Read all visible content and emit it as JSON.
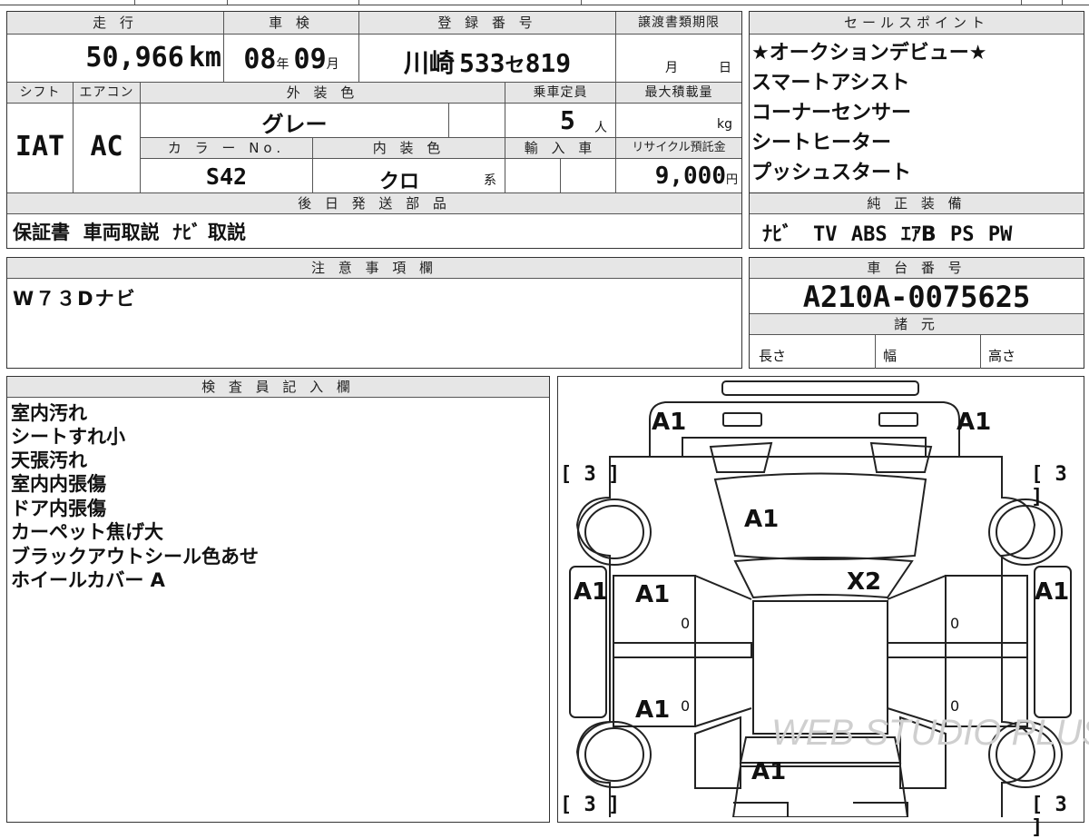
{
  "vehicle": {
    "mileage_label": "走 行",
    "mileage_value": "50,966",
    "mileage_unit": "km",
    "inspection_label": "車 検",
    "inspection_year": "08",
    "inspection_year_unit": "年",
    "inspection_month": "09",
    "inspection_month_unit": "月",
    "registration_label": "登 録 番 号",
    "registration_area": "川崎",
    "registration_class": "533",
    "registration_kana": "セ",
    "registration_number": "819",
    "transfer_deadline_label": "譲渡書類期限",
    "transfer_month_unit": "月",
    "transfer_day_unit": "日",
    "shift_label": "シフト",
    "shift_value": "IAT",
    "ac_label": "エアコン",
    "ac_value": "AC",
    "exterior_color_label": "外 装 色",
    "exterior_color_value": "グレー",
    "capacity_label": "乗車定員",
    "capacity_value": "5",
    "capacity_unit": "人",
    "max_load_label": "最大積載量",
    "max_load_unit": "kg",
    "color_no_label": "カ ラ ー No.",
    "color_no_value": "S42",
    "interior_color_label": "内 装 色",
    "interior_color_value": "クロ",
    "interior_color_suffix": "系",
    "import_label": "輸 入 車",
    "recycle_label": "リサイクル預託金",
    "recycle_value": "9,000",
    "recycle_unit": "円"
  },
  "later_parts": {
    "label": "後 日 発 送 部 品",
    "value": "保証書  車両取説  ﾅﾋﾞ 取説"
  },
  "notes": {
    "label": "注 意 事 項 欄",
    "value": "W７３Dナビ"
  },
  "sales_points": {
    "label": "セールスポイント",
    "items": [
      "★オークションデビュー★",
      "スマートアシスト",
      "コーナーセンサー",
      "シートヒーター",
      "プッシュスタート"
    ]
  },
  "equipment": {
    "label": "純 正 装 備",
    "items": [
      "ﾅﾋﾞ",
      "TV",
      "ABS",
      "ｴｱB",
      "PS",
      "PW"
    ]
  },
  "chassis": {
    "label": "車 台 番 号",
    "value": "A210A-0075625"
  },
  "specs": {
    "label": "諸 元",
    "length_label": "長さ",
    "width_label": "幅",
    "height_label": "高さ"
  },
  "inspector": {
    "label": "検 査 員 記 入 欄",
    "items": [
      "室内汚れ",
      "シートすれ小",
      "天張汚れ",
      "室内内張傷",
      "ドア内張傷",
      "カーペット焦げ大",
      "ブラックアウトシール色あせ",
      "ホイールカバー A"
    ]
  },
  "diagram": {
    "tire_marks": [
      "[ 3 ]",
      "[ 3 ]",
      "[ 3 ]",
      "[ 3 ]"
    ],
    "zero_marks": [
      "0",
      "0",
      "0",
      "0"
    ],
    "damage_marks": {
      "front_left": "A1",
      "front_right": "A1",
      "hood": "A1",
      "windshield": "X2",
      "left_side": "A1",
      "right_side": "A1",
      "left_front_door": "A1",
      "left_rear_door": "A1",
      "roof_rear": "A1"
    },
    "watermark": "WEB STUDIO PLUS"
  }
}
